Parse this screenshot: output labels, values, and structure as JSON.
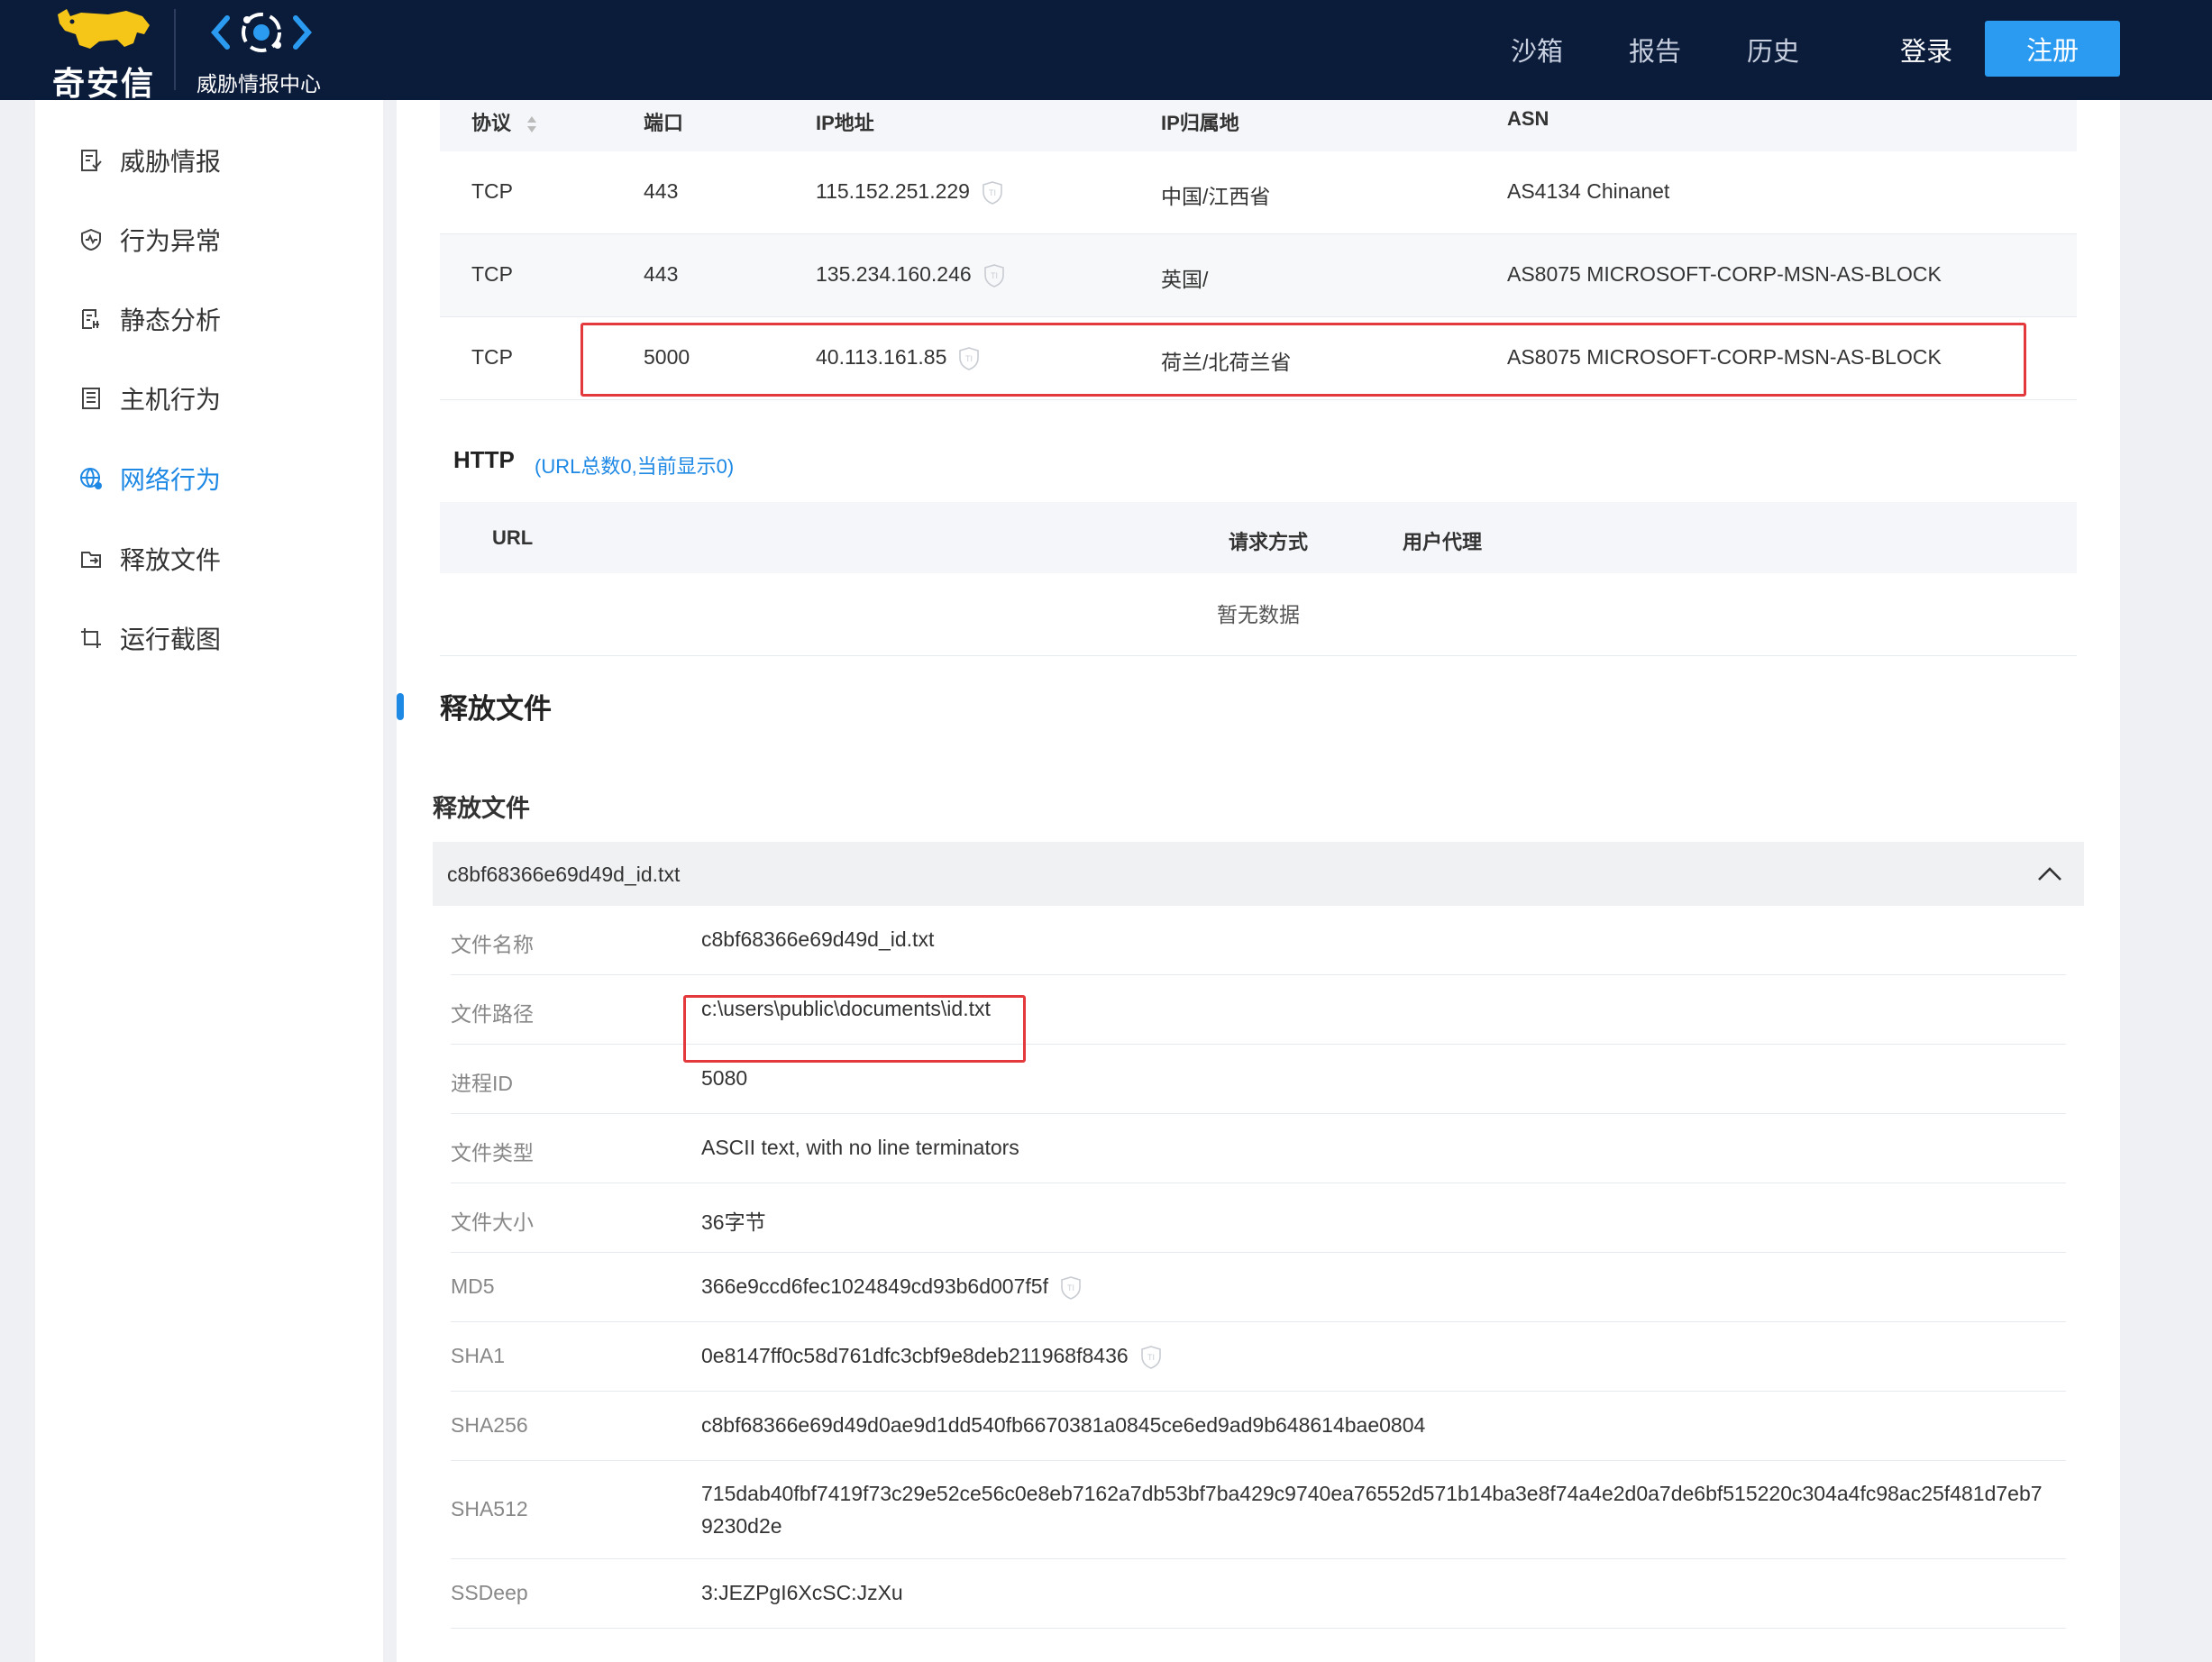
{
  "header": {
    "logo_text": "奇安信",
    "brand_text": "威胁情报中心",
    "nav": [
      "沙箱",
      "报告",
      "历史"
    ],
    "login": "登录",
    "register": "注册",
    "colors": {
      "bar": "#0b1b3a",
      "accent": "#2a9bf0"
    }
  },
  "sidebar": {
    "items": [
      {
        "label": "威胁情报",
        "icon": "report-icon"
      },
      {
        "label": "行为异常",
        "icon": "shield-icon"
      },
      {
        "label": "静态分析",
        "icon": "static-analysis-icon"
      },
      {
        "label": "主机行为",
        "icon": "host-icon"
      },
      {
        "label": "网络行为",
        "icon": "globe-icon",
        "active": true
      },
      {
        "label": "释放文件",
        "icon": "folder-icon"
      },
      {
        "label": "运行截图",
        "icon": "crop-icon"
      }
    ]
  },
  "tcp": {
    "headers": [
      "协议",
      "端口",
      "IP地址",
      "IP归属地",
      "ASN"
    ],
    "rows": [
      {
        "protocol": "TCP",
        "port": "443",
        "ip": "115.152.251.229",
        "location": "中国/江西省",
        "asn": "AS4134 Chinanet"
      },
      {
        "protocol": "TCP",
        "port": "443",
        "ip": "135.234.160.246",
        "location": "英国/",
        "asn": "AS8075 MICROSOFT-CORP-MSN-AS-BLOCK"
      },
      {
        "protocol": "TCP",
        "port": "5000",
        "ip": "40.113.161.85",
        "location": "荷兰/北荷兰省",
        "asn": "AS8075 MICROSOFT-CORP-MSN-AS-BLOCK"
      }
    ]
  },
  "http": {
    "title": "HTTP",
    "subtitle": "(URL总数0,当前显示0)",
    "headers": [
      "URL",
      "请求方式",
      "用户代理"
    ],
    "empty": "暂无数据"
  },
  "dropped": {
    "section_title": "释放文件",
    "sub_title": "释放文件",
    "file_name": "c8bf68366e69d49d_id.txt",
    "details": [
      {
        "key": "文件名称",
        "value": "c8bf68366e69d49d_id.txt"
      },
      {
        "key": "文件路径",
        "value": "c:\\users\\public\\documents\\id.txt"
      },
      {
        "key": "进程ID",
        "value": "5080"
      },
      {
        "key": "文件类型",
        "value": "ASCII text, with no line terminators"
      },
      {
        "key": "文件大小",
        "value": "36字节"
      },
      {
        "key": "MD5",
        "value": "366e9ccd6fec1024849cd93b6d007f5f"
      },
      {
        "key": "SHA1",
        "value": "0e8147ff0c58d761dfc3cbf9e8deb211968f8436"
      },
      {
        "key": "SHA256",
        "value": "c8bf68366e69d49d0ae9d1dd540fb6670381a0845ce6ed9ad9b648614bae0804"
      },
      {
        "key": "SHA512",
        "value": "715dab40fbf7419f73c29e52ce56c0e8eb7162a7db53bf7ba429c9740ea76552d571b14ba3e8f74a4e2d0a7de6bf515220c304a4fc98ac25f481d7eb79230d2e"
      },
      {
        "key": "SSDeep",
        "value": "3:JEZPgI6XcSC:JzXu"
      }
    ]
  }
}
